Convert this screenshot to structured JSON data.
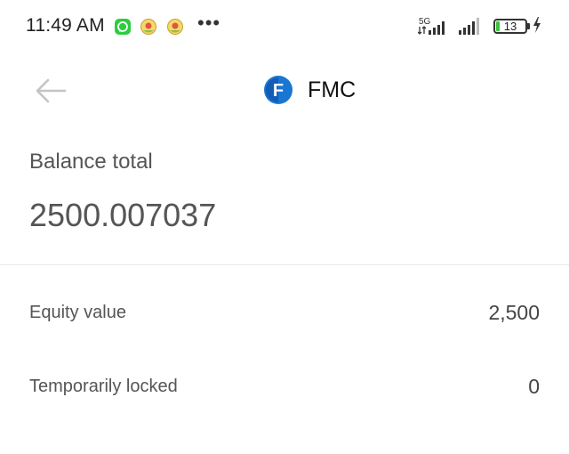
{
  "status_bar": {
    "time": "11:49 AM",
    "network_type": "5G",
    "battery_level": "13",
    "battery_fraction": 0.13,
    "battery_color": "#3ec33e",
    "more_indicator": "•••"
  },
  "header": {
    "back_icon": "arrow-left-icon",
    "coin_logo_letter": "F",
    "coin_logo_color": "#1976d2",
    "title": "FMC"
  },
  "balance": {
    "label": "Balance total",
    "value": "2500.007037"
  },
  "details": [
    {
      "label": "Equity value",
      "value": "2,500"
    },
    {
      "label": "Temporarily locked",
      "value": "0"
    }
  ]
}
